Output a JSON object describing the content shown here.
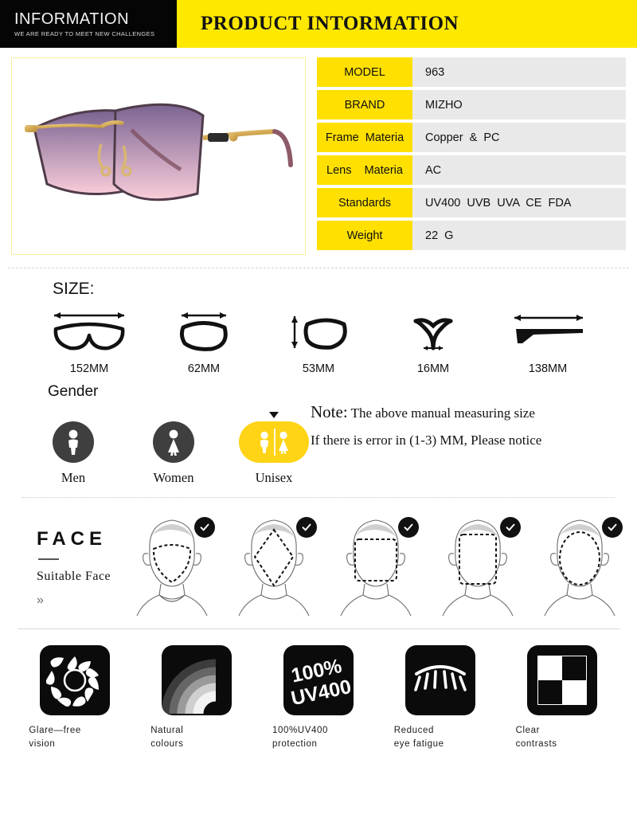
{
  "header": {
    "logo_main": "INFORMATION",
    "logo_sub": "WE ARE READY TO MEET NEW CHALLENGES",
    "title": "PRODUCT  INTORMATION"
  },
  "product_image": {
    "alt": "sunglasses-product-photo",
    "lens_gradient_top": "#6e5a86",
    "lens_gradient_bottom": "#f6c9d8",
    "frame_color": "#d8b26a"
  },
  "spec_table": {
    "rows": [
      {
        "key": "MODEL",
        "value": "963"
      },
      {
        "key": "BRAND",
        "value": "MIZHO"
      },
      {
        "key": "Frame  Materia",
        "value": "Copper  &  PC"
      },
      {
        "key": "Lens    Materia",
        "value": "AC"
      },
      {
        "key": "Standards",
        "value": "UV400  UVB  UVA  CE  FDA"
      },
      {
        "key": "Weight",
        "value": "22  G"
      }
    ]
  },
  "size": {
    "title": "SIZE:",
    "items": [
      {
        "label": "152MM",
        "icon": "frame-width-icon"
      },
      {
        "label": "62MM",
        "icon": "lens-width-icon"
      },
      {
        "label": "53MM",
        "icon": "lens-height-icon"
      },
      {
        "label": "16MM",
        "icon": "bridge-width-icon"
      },
      {
        "label": "138MM",
        "icon": "temple-length-icon"
      }
    ]
  },
  "gender": {
    "title": "Gender",
    "options": [
      {
        "label": "Men",
        "selected": false
      },
      {
        "label": "Women",
        "selected": false
      },
      {
        "label": "Unisex",
        "selected": true
      }
    ],
    "selected_color": "#ffd416"
  },
  "note": {
    "label": "Note:",
    "line1": " The above manual measuring size",
    "line2": "If there is error in (1-3) MM, Please notice"
  },
  "face": {
    "title": "FACE",
    "subtitle": "Suitable  Face",
    "chevron": "»",
    "shapes": [
      {
        "name": "heart",
        "check": true
      },
      {
        "name": "diamond",
        "check": true
      },
      {
        "name": "square",
        "check": true
      },
      {
        "name": "rectangle",
        "check": true
      },
      {
        "name": "oval",
        "check": true
      }
    ]
  },
  "features": [
    {
      "icon": "sun-glare-icon",
      "label": "Glare—free\nvision"
    },
    {
      "icon": "rainbow-colours-icon",
      "label": "Natural\ncolours"
    },
    {
      "icon": "uv400-icon",
      "label": "100%UV400\nprotection"
    },
    {
      "icon": "eyelash-icon",
      "label": "Reduced\neye fatigue"
    },
    {
      "icon": "checkerboard-contrast-icon",
      "label": "Clear\ncontrasts"
    }
  ]
}
